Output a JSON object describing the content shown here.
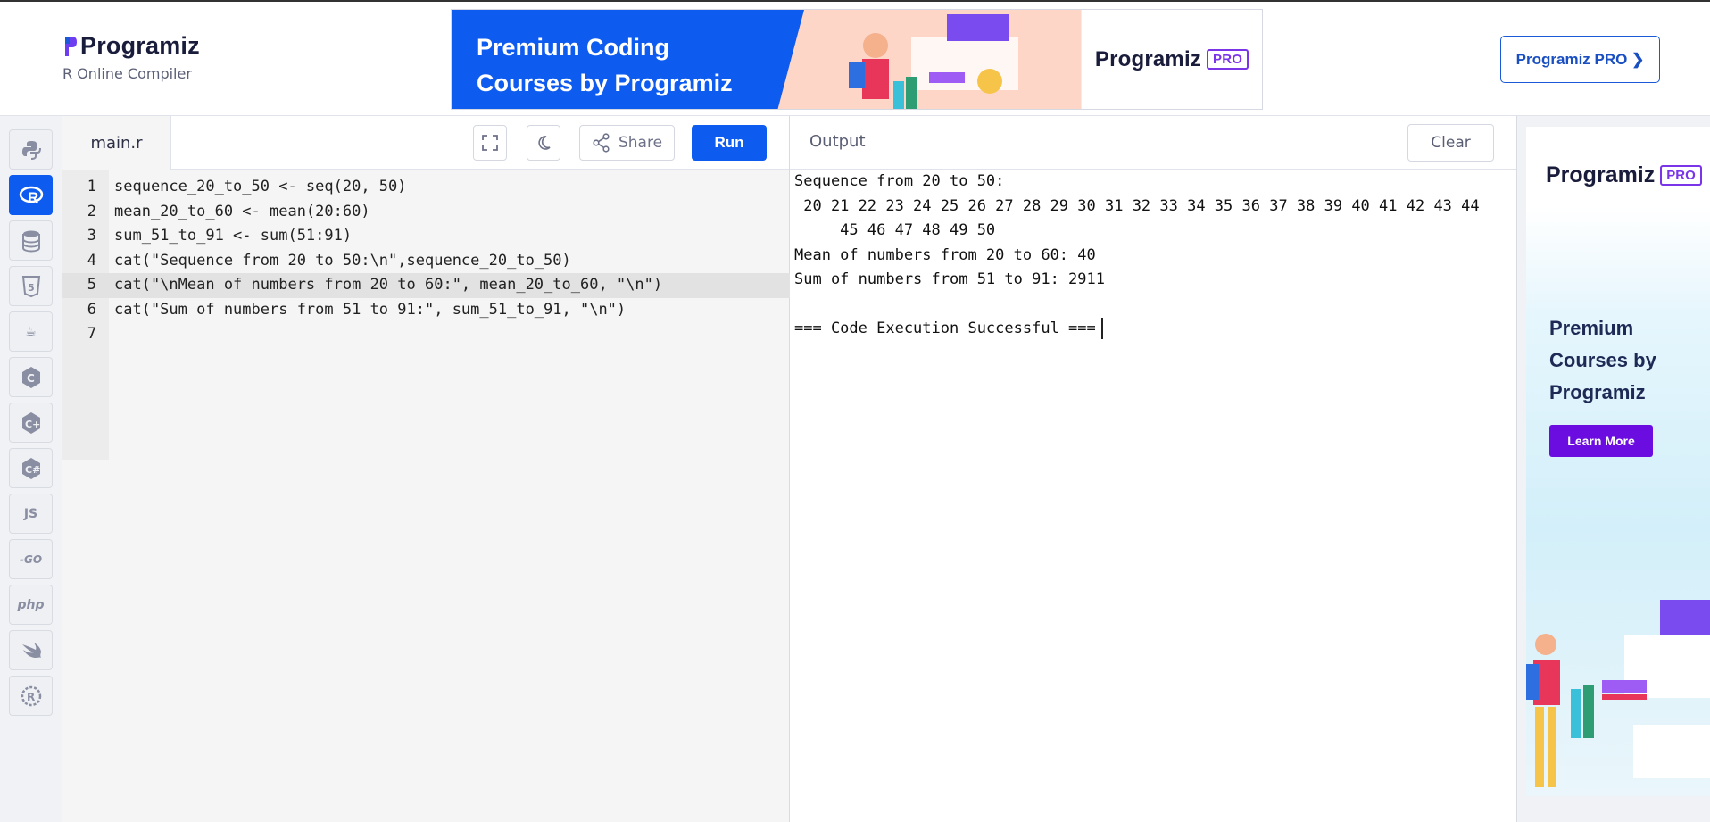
{
  "header": {
    "logo_text": "Programiz",
    "subtitle": "R Online Compiler",
    "pro_button": "Programiz PRO ❯"
  },
  "banner": {
    "line1": "Premium Coding",
    "line2": "Courses by Programiz",
    "logo_text": "Programiz",
    "pro_tag": "PRO"
  },
  "sidebar": {
    "items": [
      {
        "name": "python",
        "label": ""
      },
      {
        "name": "r",
        "label": "R"
      },
      {
        "name": "sql",
        "label": ""
      },
      {
        "name": "html",
        "label": "5"
      },
      {
        "name": "java",
        "label": "☕"
      },
      {
        "name": "c",
        "label": "C"
      },
      {
        "name": "cpp",
        "label": "C+"
      },
      {
        "name": "csharp",
        "label": "C#"
      },
      {
        "name": "js",
        "label": "JS"
      },
      {
        "name": "go",
        "label": "-GO"
      },
      {
        "name": "php",
        "label": "php"
      },
      {
        "name": "swift",
        "label": ""
      },
      {
        "name": "rust",
        "label": "R"
      }
    ]
  },
  "editor": {
    "file_tab": "main.r",
    "share_label": "Share",
    "run_label": "Run",
    "lines": [
      {
        "num": "1",
        "text": "sequence_20_to_50 <- seq(20, 50)"
      },
      {
        "num": "2",
        "text": "mean_20_to_60 <- mean(20:60)"
      },
      {
        "num": "3",
        "text": "sum_51_to_91 <- sum(51:91)"
      },
      {
        "num": "4",
        "text": "cat(\"Sequence from 20 to 50:\\n\",sequence_20_to_50)"
      },
      {
        "num": "5",
        "text": "cat(\"\\nMean of numbers from 20 to 60:\", mean_20_to_60, \"\\n\")"
      },
      {
        "num": "6",
        "text": "cat(\"Sum of numbers from 51 to 91:\", sum_51_to_91, \"\\n\")"
      },
      {
        "num": "7",
        "text": ""
      }
    ]
  },
  "output": {
    "title": "Output",
    "clear_label": "Clear",
    "lines": [
      "Sequence from 20 to 50:",
      " 20 21 22 23 24 25 26 27 28 29 30 31 32 33 34 35 36 37 38 39 40 41 42 43 44",
      "     45 46 47 48 49 50",
      "Mean of numbers from 20 to 60: 40",
      "Sum of numbers from 51 to 91: 2911",
      "",
      "=== Code Execution Successful ==="
    ]
  },
  "ad": {
    "logo_text": "Programiz",
    "pro_tag": "PRO",
    "title": "Premium Courses by Programiz",
    "button": "Learn More"
  },
  "colors": {
    "accent": "#0e5bf0",
    "ad_button": "#6b0de0"
  }
}
